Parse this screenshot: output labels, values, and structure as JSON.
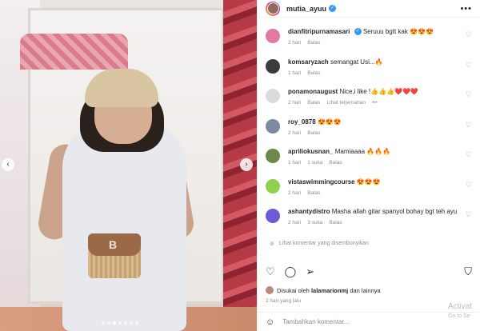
{
  "post": {
    "username": "mutia_ayuu",
    "more_icon": "ellipsis-icon"
  },
  "comments": [
    {
      "user": "dianfitripurnamasari",
      "verified": true,
      "text": "Seruuu bgtt kak 😍😍😍",
      "time": "2 hari",
      "likes": "",
      "reply": "Balas",
      "translate": "",
      "avatar_color": "#e07aa0"
    },
    {
      "user": "komsaryzach",
      "verified": false,
      "text": "semangat Usi...🔥",
      "time": "1 hari",
      "likes": "",
      "reply": "Balas",
      "translate": "",
      "avatar_color": "#3b3b3b"
    },
    {
      "user": "ponamonaugust",
      "verified": false,
      "text": "Nice,i like !👍👍👍❤️❤️❤️",
      "time": "2 hari",
      "likes": "",
      "reply": "Balas",
      "translate": "Lihat terjemahan",
      "avatar_color": "#dbdbdb"
    },
    {
      "user": "roy_0878",
      "verified": false,
      "text": "😍😍😍",
      "time": "2 hari",
      "likes": "",
      "reply": "Balas",
      "translate": "",
      "avatar_color": "#7a8aa0"
    },
    {
      "user": "apriliokusnan_",
      "verified": false,
      "text": "Mamiaaaa 🔥🔥🔥",
      "time": "1 hari",
      "likes": "1 suka",
      "reply": "Balas",
      "translate": "",
      "avatar_color": "#6a8a4a"
    },
    {
      "user": "vistaswimmingcourse",
      "verified": false,
      "text": "😍😍😍",
      "time": "2 hari",
      "likes": "",
      "reply": "Balas",
      "translate": "",
      "avatar_color": "#8fd14f"
    },
    {
      "user": "ashantydistro",
      "verified": false,
      "text": "Masha allah gitar spanyol bohay bgt teh ayu",
      "time": "2 hari",
      "likes": "3 suka",
      "reply": "Balas",
      "translate": "",
      "avatar_color": "#6b5bd6"
    }
  ],
  "hidden_comments_label": "Lihat komentar yang disembunyikan",
  "likes": {
    "prefix": "Disukai oleh",
    "user": "lalamarionmj",
    "suffix": "dan lainnya"
  },
  "post_time": "2 hari yang lalu",
  "composer": {
    "placeholder": "Tambahkan komentar..."
  },
  "watermark": {
    "line1": "Activat",
    "line2": "Go to Se"
  },
  "icons": {
    "heart": "heart-icon",
    "comment": "comment-icon",
    "share": "share-icon",
    "save": "bookmark-icon",
    "emoji": "emoji-icon",
    "eye_off": "eye-slash-icon"
  }
}
